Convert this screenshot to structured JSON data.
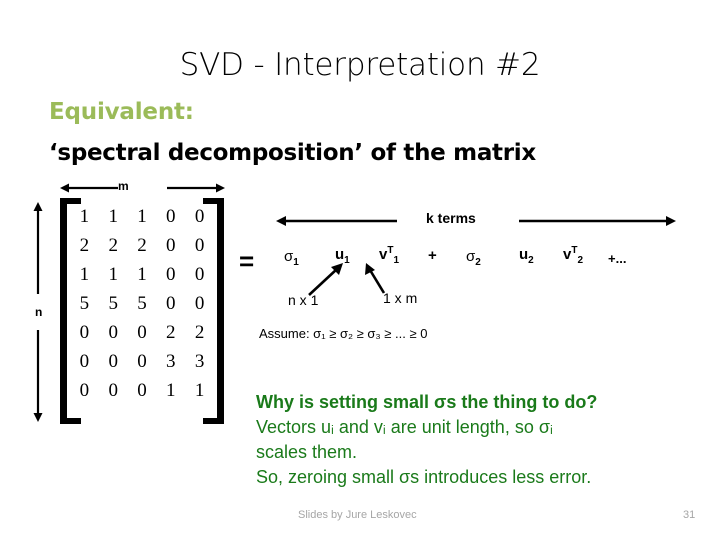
{
  "slide": {
    "title": "SVD - Interpretation #2",
    "subtitle_label": "Equivalent:",
    "subtitle_text": "‘spectral decomposition’ of the matrix"
  },
  "matrix": {
    "dim_label_m": "m",
    "dim_label_n": "n",
    "rows": [
      [
        "1",
        "1",
        "1",
        "0",
        "0"
      ],
      [
        "2",
        "2",
        "2",
        "0",
        "0"
      ],
      [
        "1",
        "1",
        "1",
        "0",
        "0"
      ],
      [
        "5",
        "5",
        "5",
        "0",
        "0"
      ],
      [
        "0",
        "0",
        "0",
        "2",
        "2"
      ],
      [
        "0",
        "0",
        "0",
        "3",
        "3"
      ],
      [
        "0",
        "0",
        "0",
        "1",
        "1"
      ]
    ],
    "equals_sign": "="
  },
  "expansion": {
    "k_terms_label": "k  terms",
    "sigma1": "σ",
    "sigma1_sub": "1",
    "u1": "u",
    "u1_sub": "1",
    "v1": "v",
    "v1_sup": "T",
    "v1_sub": "1",
    "plus": "+",
    "sigma2": "σ",
    "sigma2_sub": "2",
    "u2": "u",
    "u2_sub": "2",
    "v2": "v",
    "v2_sup": "T",
    "v2_sub": "2",
    "plus_dots": "+...",
    "annotation_nx1": "n x 1",
    "annotation_1xm": "1 x m",
    "assume": "Assume: σ₁ ≥ σ₂ ≥ σ₃ ≥ ... ≥ 0"
  },
  "explanation": {
    "line1": "Why is setting small σs the thing to do?",
    "line2": "Vectors uᵢ and vᵢ are unit length, so σᵢ",
    "line3": "scales them.",
    "line4": "So, zeroing small σs introduces less error."
  },
  "footer": {
    "credit": "Slides by Jure Leskovec",
    "page_number": "31"
  },
  "colors": {
    "accent_olive": "#9bbb59",
    "explanation_green": "#1a7a1a",
    "footer_gray": "#a6a6a6",
    "text_black": "#000000",
    "background": "#ffffff"
  }
}
